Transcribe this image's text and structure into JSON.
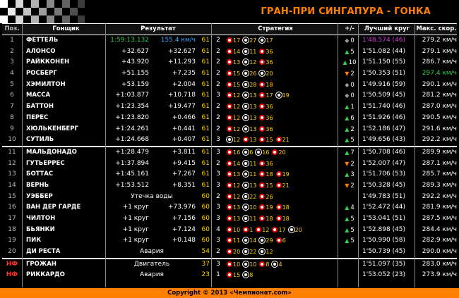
{
  "title": "ГРАН-ПРИ СИНГАПУРА - ГОНКА",
  "headers": {
    "pos": "Поз.",
    "driver": "Гонщик",
    "result": "Результат",
    "strategy": "Стратегия",
    "pm": "+/-",
    "best": "Лучший круг",
    "top": "Макс. скор."
  },
  "colors": {
    "fastest_lap": "#d13bd1",
    "top_speed": "#2bd14a",
    "leader_time": "#2bd14a",
    "leader_speed": "#3aa9ff"
  },
  "rows": [
    {
      "pos": "1",
      "driver": "ФЕТТЕЛЬ",
      "t1": "1:59:13.132",
      "t2": "155.4 км/ч",
      "laps": "61",
      "stops": "2",
      "strat": [
        [
          "r",
          "17"
        ],
        [
          "w",
          "27"
        ],
        [
          "w",
          "17"
        ]
      ],
      "pm_dir": "same",
      "pm": "0",
      "best": "1'48.574 (46)",
      "top": "279.2 км/ч",
      "best_hi": true
    },
    {
      "pos": "2",
      "driver": "АЛОНСО",
      "t1": "+32.627",
      "t2": "+32.627",
      "laps": "61",
      "stops": "2",
      "strat": [
        [
          "r",
          "14"
        ],
        [
          "w",
          "11"
        ],
        [
          "r",
          "36"
        ]
      ],
      "pm_dir": "up",
      "pm": "5",
      "best": "1'51.082 (44)",
      "top": "279.1 км/ч"
    },
    {
      "pos": "3",
      "driver": "РАЙККОНЕН",
      "t1": "+43.920",
      "t2": "+11.293",
      "laps": "61",
      "stops": "2",
      "strat": [
        [
          "r",
          "13"
        ],
        [
          "w",
          "12"
        ],
        [
          "r",
          "36"
        ]
      ],
      "pm_dir": "up",
      "pm": "10",
      "best": "1'51.150 (55)",
      "top": "286.7 км/ч"
    },
    {
      "pos": "4",
      "driver": "РОСБЕРГ",
      "t1": "+51.155",
      "t2": "+7.235",
      "laps": "61",
      "stops": "2",
      "strat": [
        [
          "r",
          "15"
        ],
        [
          "w",
          "26"
        ],
        [
          "w",
          "20"
        ]
      ],
      "pm_dir": "down",
      "pm": "2",
      "best": "1'50.353 (51)",
      "top": "297.4 км/ч",
      "top_hi": true
    },
    {
      "pos": "5",
      "driver": "ХЭМИЛТОН",
      "t1": "+53.159",
      "t2": "+2.004",
      "laps": "61",
      "stops": "2",
      "strat": [
        [
          "r",
          "15"
        ],
        [
          "w",
          "28"
        ],
        [
          "r",
          "18"
        ]
      ],
      "pm_dir": "same",
      "pm": "0",
      "best": "1'49.916 (59)",
      "top": "290.1 км/ч"
    },
    {
      "pos": "6",
      "driver": "МАССА",
      "t1": "+1:03.877",
      "t2": "+10.718",
      "laps": "61",
      "stops": "3",
      "strat": [
        [
          "r",
          "12"
        ],
        [
          "w",
          "13"
        ],
        [
          "r",
          "17"
        ],
        [
          "w",
          "19"
        ]
      ],
      "pm_dir": "same",
      "pm": "0",
      "best": "1'50.509 (45)",
      "top": "281.2 км/ч"
    },
    {
      "pos": "7",
      "driver": "БАТТОН",
      "t1": "+1:23.354",
      "t2": "+19.477",
      "laps": "61",
      "stops": "2",
      "strat": [
        [
          "r",
          "12"
        ],
        [
          "w",
          "13"
        ],
        [
          "r",
          "36"
        ]
      ],
      "pm_dir": "up",
      "pm": "1",
      "best": "1'51.740 (46)",
      "top": "287.0 км/ч"
    },
    {
      "pos": "8",
      "driver": "ПЕРЕС",
      "t1": "+1:23.820",
      "t2": "+0.466",
      "laps": "61",
      "stops": "2",
      "strat": [
        [
          "r",
          "12"
        ],
        [
          "w",
          "13"
        ],
        [
          "r",
          "36"
        ]
      ],
      "pm_dir": "up",
      "pm": "6",
      "best": "1'51.926 (46)",
      "top": "290.5 км/ч"
    },
    {
      "pos": "9",
      "driver": "ХЮЛЬКЕНБЕРГ",
      "t1": "+1:24.261",
      "t2": "+0.441",
      "laps": "61",
      "stops": "2",
      "strat": [
        [
          "r",
          "12"
        ],
        [
          "w",
          "13"
        ],
        [
          "r",
          "36"
        ]
      ],
      "pm_dir": "up",
      "pm": "2",
      "best": "1'52.186 (47)",
      "top": "291.6 км/ч"
    },
    {
      "pos": "10",
      "driver": "СУТИЛЬ",
      "t1": "+1:24.668",
      "t2": "+0.407",
      "laps": "61",
      "stops": "3",
      "strat": [
        [
          "w",
          "12"
        ],
        [
          "r",
          "13"
        ],
        [
          "r",
          "15"
        ],
        [
          "r",
          "21"
        ]
      ],
      "pm_dir": "up",
      "pm": "5",
      "best": "1'49.656 (43)",
      "top": "292.2 км/ч"
    },
    {
      "pos": "11",
      "driver": "МАЛЬДОНАДО",
      "t1": "+1:28.479",
      "t2": "+3.811",
      "laps": "61",
      "stops": "3",
      "strat": [
        [
          "r",
          "16"
        ],
        [
          "w",
          "6"
        ],
        [
          "w",
          "16"
        ],
        [
          "r",
          "20"
        ]
      ],
      "pm_dir": "up",
      "pm": "7",
      "best": "1'50.708 (46)",
      "top": "289.9 км/ч",
      "sep_before": true
    },
    {
      "pos": "12",
      "driver": "ГУТЬЕРРЕС",
      "t1": "+1:37.894",
      "t2": "+9.415",
      "laps": "61",
      "stops": "2",
      "strat": [
        [
          "r",
          "14"
        ],
        [
          "w",
          "11"
        ],
        [
          "r",
          "36"
        ]
      ],
      "pm_dir": "down",
      "pm": "2",
      "best": "1'52.007 (47)",
      "top": "287.1 км/ч"
    },
    {
      "pos": "13",
      "driver": "БОТТАС",
      "t1": "+1:45.161",
      "t2": "+7.267",
      "laps": "61",
      "stops": "3",
      "strat": [
        [
          "r",
          "13"
        ],
        [
          "w",
          "11"
        ],
        [
          "r",
          "18"
        ],
        [
          "r",
          "19"
        ]
      ],
      "pm_dir": "up",
      "pm": "3",
      "best": "1'51.706 (53)",
      "top": "285.7 км/ч"
    },
    {
      "pos": "14",
      "driver": "ВЕРНЬ",
      "t1": "+1:53.512",
      "t2": "+8.351",
      "laps": "61",
      "stops": "3",
      "strat": [
        [
          "r",
          "12"
        ],
        [
          "w",
          "13"
        ],
        [
          "r",
          "15"
        ],
        [
          "r",
          "21"
        ]
      ],
      "pm_dir": "down",
      "pm": "2",
      "best": "1'50.328 (45)",
      "top": "289.3 км/ч"
    },
    {
      "pos": "15",
      "driver": "УЭББЕР",
      "result_text": "Утечка воды",
      "laps": "60",
      "stops": "2",
      "strat": [
        [
          "r",
          "12"
        ],
        [
          "w",
          "22"
        ],
        [
          "r",
          "26"
        ]
      ],
      "pm_dir": "",
      "pm": "",
      "best": "1'49.783 (51)",
      "top": "292.2 км/ч"
    },
    {
      "pos": "16",
      "driver": "ВАН ДЕР ГАРДЕ",
      "t1": "+1 круг",
      "t2": "+73.976",
      "laps": "60",
      "stops": "3",
      "strat": [
        [
          "r",
          "13"
        ],
        [
          "w",
          "10"
        ],
        [
          "r",
          "19"
        ],
        [
          "r",
          "18"
        ]
      ],
      "pm_dir": "up",
      "pm": "4",
      "best": "1'52.472 (44)",
      "top": "281.9 км/ч"
    },
    {
      "pos": "17",
      "driver": "ЧИЛТОН",
      "t1": "+1 круг",
      "t2": "+7.156",
      "laps": "60",
      "stops": "3",
      "strat": [
        [
          "r",
          "13"
        ],
        [
          "w",
          "11"
        ],
        [
          "r",
          "18"
        ],
        [
          "r",
          "18"
        ]
      ],
      "pm_dir": "up",
      "pm": "5",
      "best": "1'53.041 (51)",
      "top": "287.5 км/ч"
    },
    {
      "pos": "18",
      "driver": "БЬЯНКИ",
      "t1": "+1 круг",
      "t2": "+7.124",
      "laps": "60",
      "stops": "4",
      "strat": [
        [
          "r",
          "10"
        ],
        [
          "r",
          "1"
        ],
        [
          "r",
          "12"
        ],
        [
          "r",
          "17"
        ],
        [
          "w",
          "20"
        ]
      ],
      "pm_dir": "up",
      "pm": "5",
      "best": "1'52.898 (45)",
      "top": "284.4 км/ч"
    },
    {
      "pos": "19",
      "driver": "ПИК",
      "t1": "+1 круг",
      "t2": "+0.148",
      "laps": "60",
      "stops": "3",
      "strat": [
        [
          "r",
          "11"
        ],
        [
          "w",
          "14"
        ],
        [
          "w",
          "29"
        ],
        [
          "r",
          "6"
        ]
      ],
      "pm_dir": "up",
      "pm": "5",
      "best": "1'50.990 (58)",
      "top": "282.9 км/ч"
    },
    {
      "pos": "20",
      "driver": "ДИ РЕСТА",
      "result_text": "Авария",
      "laps": "54",
      "stops": "2",
      "strat": [
        [
          "r",
          "20"
        ],
        [
          "w",
          "22"
        ],
        [
          "w",
          "12"
        ]
      ],
      "pm_dir": "",
      "pm": "",
      "best": "1'50.739 (45)",
      "top": "290.0 км/ч"
    },
    {
      "pos": "НФ",
      "driver": "ГРОЖАН",
      "result_text": "Двигатель",
      "laps": "37",
      "stops": "3",
      "strat": [
        [
          "r",
          "10"
        ],
        [
          "w",
          "10"
        ],
        [
          "r",
          "8"
        ],
        [
          "w",
          "4"
        ]
      ],
      "pm_dir": "",
      "pm": "",
      "best": "1'51.097 (35)",
      "top": "283.0 км/ч",
      "dnf": true,
      "sep_before": true
    },
    {
      "pos": "НФ",
      "driver": "РИККАРДО",
      "result_text": "Авария",
      "laps": "23",
      "stops": "1",
      "strat": [
        [
          "r",
          "15"
        ],
        [
          "w",
          "8"
        ]
      ],
      "pm_dir": "",
      "pm": "",
      "best": "1'53.052 (23)",
      "top": "273.9 км/ч",
      "dnf": true
    }
  ],
  "footer": "Copyright © 2013 «Чемпионат.com»"
}
